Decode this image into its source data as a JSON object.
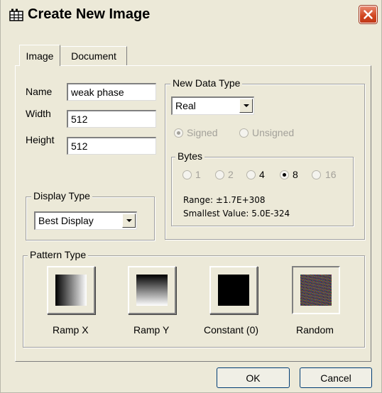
{
  "window": {
    "title": "Create New Image",
    "title_icon": "image-grid-icon",
    "close_icon": "close-icon"
  },
  "tabs": [
    {
      "label": "Image",
      "active": true
    },
    {
      "label": "Document",
      "active": false
    }
  ],
  "fields": {
    "name": {
      "label": "Name",
      "value": "weak phase"
    },
    "width": {
      "label": "Width",
      "value": "512"
    },
    "height": {
      "label": "Height",
      "value": "512"
    }
  },
  "new_data_type": {
    "title": "New Data Type",
    "selected": "Real",
    "signed_label": "Signed",
    "unsigned_label": "Unsigned",
    "signed_selected": true,
    "bytes": {
      "title": "Bytes",
      "options": [
        "1",
        "2",
        "4",
        "8",
        "16"
      ],
      "selected": "8",
      "enabled": [
        "4",
        "8"
      ]
    },
    "range_text": "Range: ±1.7E+308",
    "smallest_text": "Smallest Value: 5.0E-324"
  },
  "display_type": {
    "title": "Display Type",
    "selected": "Best Display"
  },
  "pattern_type": {
    "title": "Pattern Type",
    "options": [
      {
        "label": "Ramp X",
        "icon": "ramp-x-gradient-icon"
      },
      {
        "label": "Ramp Y",
        "icon": "ramp-y-gradient-icon"
      },
      {
        "label": "Constant (0)",
        "icon": "constant-black-icon"
      },
      {
        "label": "Random",
        "icon": "random-noise-icon"
      }
    ],
    "selected": "Random"
  },
  "buttons": {
    "ok": "OK",
    "cancel": "Cancel"
  },
  "colors": {
    "dialog_bg": "#ece9d8",
    "close_button": "#d0441d",
    "disabled_text": "#a3a19a"
  }
}
